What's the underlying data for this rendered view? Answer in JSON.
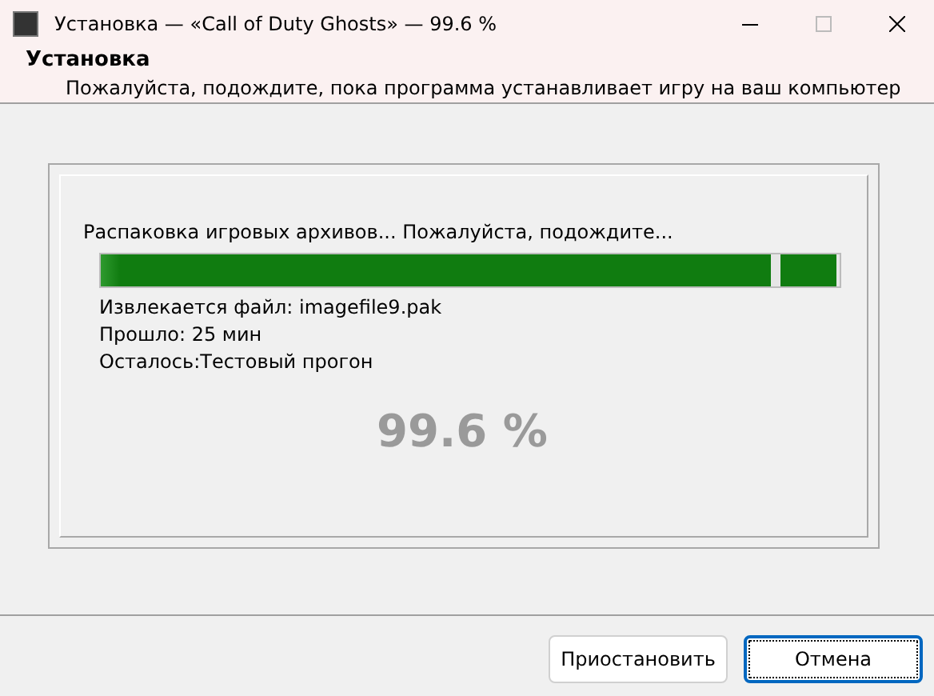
{
  "window": {
    "title": "Установка — «Call of Duty Ghosts» — 99.6 %"
  },
  "header": {
    "title": "Установка",
    "subtitle": "Пожалуйста, подождите, пока программа устанавливает игру на ваш компьютер"
  },
  "progress": {
    "status": "Распаковка игровых архивов... Пожалуйста, подождите...",
    "level": 0.996,
    "lines": [
      "Извлекается файл: imagefile9.pak",
      "Прошло: 25 мин",
      "Осталось:Тестовый прогон"
    ],
    "percent": "99.6 %"
  },
  "buttons": [
    {
      "label": "Приостановить",
      "selected": false
    },
    {
      "label": "Отмена",
      "selected": true
    }
  ]
}
